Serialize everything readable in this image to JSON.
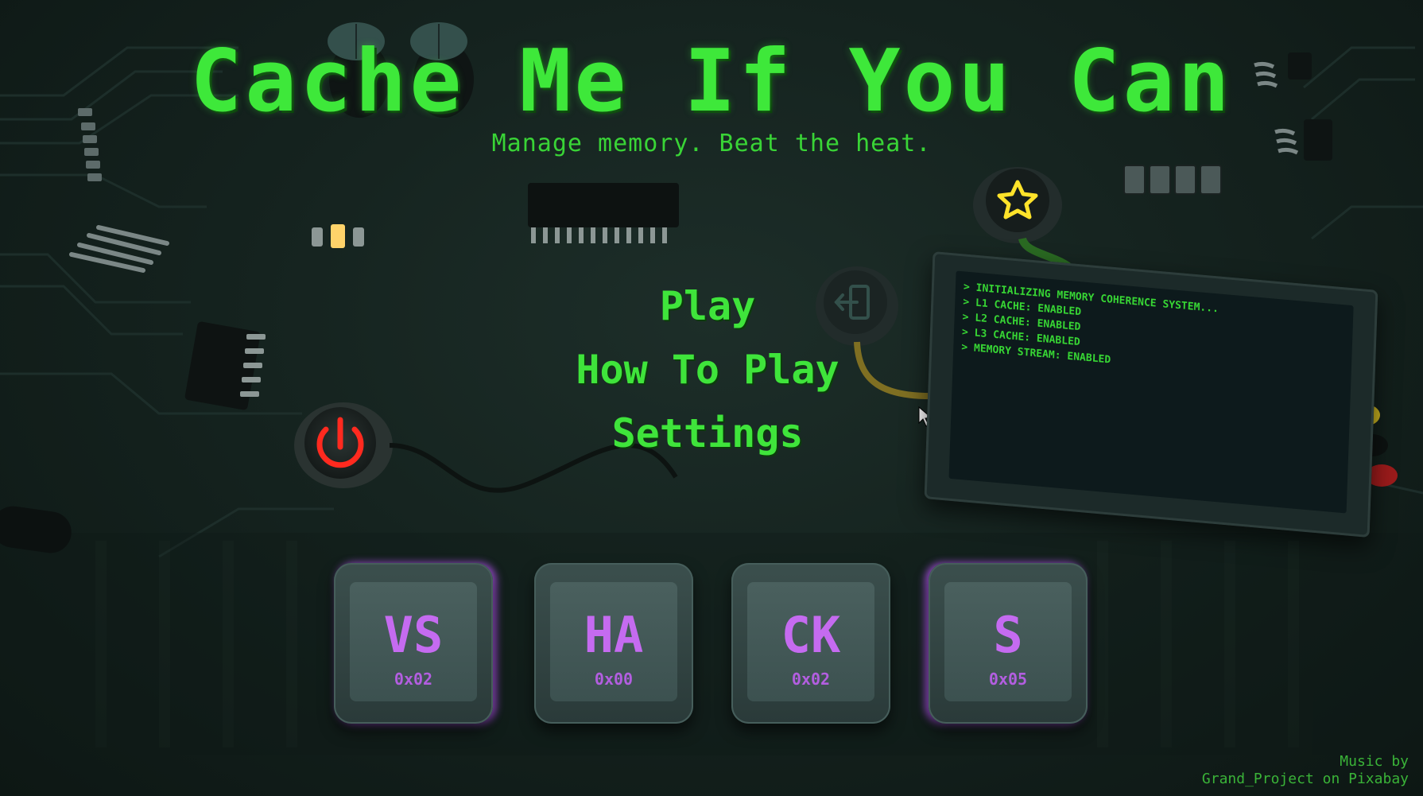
{
  "game": {
    "title": "Cache Me If You Can",
    "subtitle": "Manage memory. Beat the heat."
  },
  "menu": {
    "items": [
      {
        "label": "Play"
      },
      {
        "label": "How To Play"
      },
      {
        "label": "Settings"
      }
    ]
  },
  "terminal": {
    "lines": [
      "> INITIALIZING MEMORY COHERENCE SYSTEM...",
      "> L1 CACHE: ENABLED",
      "> L2 CACHE: ENABLED",
      "> L3 CACHE: ENABLED",
      "> MEMORY STREAM: ENABLED"
    ]
  },
  "keys": [
    {
      "label": "VS",
      "hex": "0x02"
    },
    {
      "label": "HA",
      "hex": "0x00"
    },
    {
      "label": "CK",
      "hex": "0x02"
    },
    {
      "label": "S",
      "hex": "0x05"
    }
  ],
  "credits": {
    "line1": "Music by",
    "line2": "Grand_Project on Pixabay"
  },
  "icons": {
    "power": "power-icon",
    "star": "star-icon",
    "exit": "exit-icon",
    "cursor": "mouse-cursor-icon"
  },
  "colors": {
    "title_green": "#3ee83a",
    "key_purple": "#c56bf0",
    "power_red": "#ff2a1f",
    "star_yellow": "#ffe32a",
    "background": "#15231f"
  }
}
